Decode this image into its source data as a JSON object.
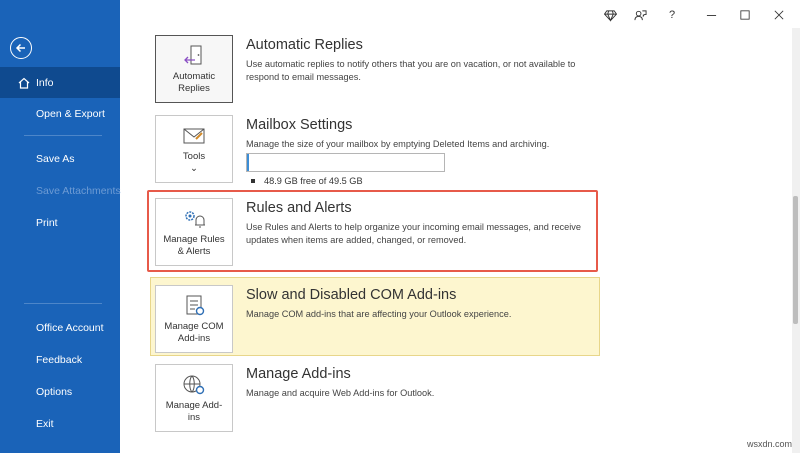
{
  "sidebar": {
    "info": "Info",
    "open_export": "Open & Export",
    "save_as": "Save As",
    "save_attachments": "Save Attachments",
    "print": "Print",
    "office_account": "Office Account",
    "feedback": "Feedback",
    "options": "Options",
    "exit": "Exit"
  },
  "sections": {
    "automatic_replies": {
      "button_label_1": "Automatic",
      "button_label_2": "Replies",
      "title": "Automatic Replies",
      "description": "Use automatic replies to notify others that you are on vacation, or not available to respond to email messages."
    },
    "mailbox_settings": {
      "button_label": "Tools",
      "title": "Mailbox Settings",
      "description": "Manage the size of your mailbox by emptying Deleted Items and archiving.",
      "storage_text": "48.9 GB free of 49.5 GB",
      "used_fraction": 0.012
    },
    "rules_alerts": {
      "button_label_1": "Manage Rules",
      "button_label_2": "& Alerts",
      "title": "Rules and Alerts",
      "description": "Use Rules and Alerts to help organize your incoming email messages, and receive updates when items are added, changed, or removed."
    },
    "com_addins": {
      "button_label_1": "Manage COM",
      "button_label_2": "Add-ins",
      "title": "Slow and Disabled COM Add-ins",
      "description": "Manage COM add-ins that are affecting your Outlook experience."
    },
    "addins": {
      "button_label_1": "Manage Add-",
      "button_label_2": "ins",
      "title": "Manage Add-ins",
      "description": "Manage and acquire Web Add-ins for Outlook."
    }
  },
  "colors": {
    "sidebar": "#1a63b8",
    "selected_nav": "#0f4a8f",
    "highlight_border": "#e75a4a",
    "addins_background": "#fdf6cf"
  },
  "watermark": "wsxdn.com"
}
